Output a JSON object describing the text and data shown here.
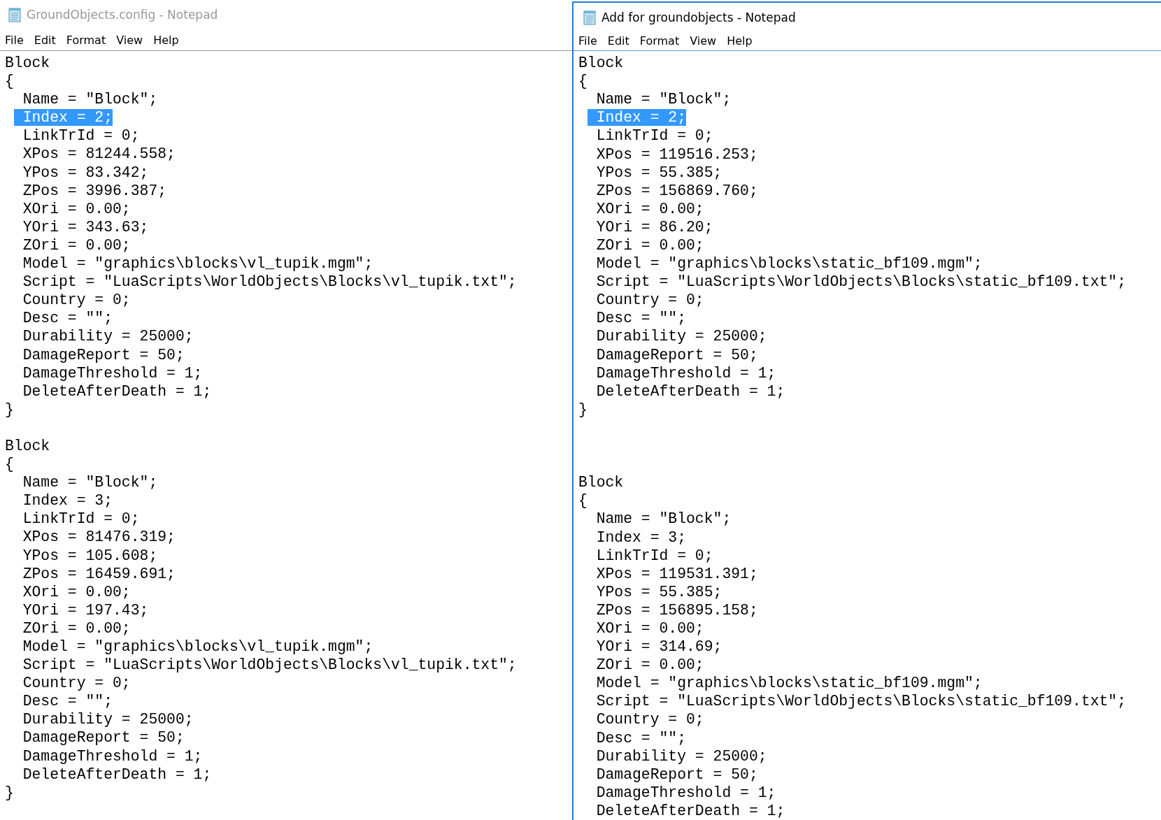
{
  "windows": [
    {
      "title": "GroundObjects.config - Notepad",
      "active": false,
      "menu": [
        "File",
        "Edit",
        "Format",
        "View",
        "Help"
      ],
      "lines": [
        {
          "kind": "text",
          "text": "Block",
          "selected": false
        },
        {
          "kind": "text",
          "text": "{",
          "selected": false
        },
        {
          "kind": "text",
          "text": "  Name = \"Block\";",
          "selected": false
        },
        {
          "kind": "text",
          "text": "  Index = 2;",
          "selected": true
        },
        {
          "kind": "text",
          "text": "  LinkTrId = 0;",
          "selected": false
        },
        {
          "kind": "text",
          "text": "  XPos = 81244.558;",
          "selected": false
        },
        {
          "kind": "text",
          "text": "  YPos = 83.342;",
          "selected": false
        },
        {
          "kind": "text",
          "text": "  ZPos = 3996.387;",
          "selected": false
        },
        {
          "kind": "text",
          "text": "  XOri = 0.00;",
          "selected": false
        },
        {
          "kind": "text",
          "text": "  YOri = 343.63;",
          "selected": false
        },
        {
          "kind": "text",
          "text": "  ZOri = 0.00;",
          "selected": false
        },
        {
          "kind": "text",
          "text": "  Model = \"graphics\\blocks\\vl_tupik.mgm\";",
          "selected": false
        },
        {
          "kind": "text",
          "text": "  Script = \"LuaScripts\\WorldObjects\\Blocks\\vl_tupik.txt\";",
          "selected": false
        },
        {
          "kind": "text",
          "text": "  Country = 0;",
          "selected": false
        },
        {
          "kind": "text",
          "text": "  Desc = \"\";",
          "selected": false
        },
        {
          "kind": "text",
          "text": "  Durability = 25000;",
          "selected": false
        },
        {
          "kind": "text",
          "text": "  DamageReport = 50;",
          "selected": false
        },
        {
          "kind": "text",
          "text": "  DamageThreshold = 1;",
          "selected": false
        },
        {
          "kind": "text",
          "text": "  DeleteAfterDeath = 1;",
          "selected": false
        },
        {
          "kind": "text",
          "text": "}",
          "selected": false
        },
        {
          "kind": "blank"
        },
        {
          "kind": "text",
          "text": "Block",
          "selected": false
        },
        {
          "kind": "text",
          "text": "{",
          "selected": false
        },
        {
          "kind": "text",
          "text": "  Name = \"Block\";",
          "selected": false
        },
        {
          "kind": "text",
          "text": "  Index = 3;",
          "selected": false
        },
        {
          "kind": "text",
          "text": "  LinkTrId = 0;",
          "selected": false
        },
        {
          "kind": "text",
          "text": "  XPos = 81476.319;",
          "selected": false
        },
        {
          "kind": "text",
          "text": "  YPos = 105.608;",
          "selected": false
        },
        {
          "kind": "text",
          "text": "  ZPos = 16459.691;",
          "selected": false
        },
        {
          "kind": "text",
          "text": "  XOri = 0.00;",
          "selected": false
        },
        {
          "kind": "text",
          "text": "  YOri = 197.43;",
          "selected": false
        },
        {
          "kind": "text",
          "text": "  ZOri = 0.00;",
          "selected": false
        },
        {
          "kind": "text",
          "text": "  Model = \"graphics\\blocks\\vl_tupik.mgm\";",
          "selected": false
        },
        {
          "kind": "text",
          "text": "  Script = \"LuaScripts\\WorldObjects\\Blocks\\vl_tupik.txt\";",
          "selected": false
        },
        {
          "kind": "text",
          "text": "  Country = 0;",
          "selected": false
        },
        {
          "kind": "text",
          "text": "  Desc = \"\";",
          "selected": false
        },
        {
          "kind": "text",
          "text": "  Durability = 25000;",
          "selected": false
        },
        {
          "kind": "text",
          "text": "  DamageReport = 50;",
          "selected": false
        },
        {
          "kind": "text",
          "text": "  DamageThreshold = 1;",
          "selected": false
        },
        {
          "kind": "text",
          "text": "  DeleteAfterDeath = 1;",
          "selected": false
        },
        {
          "kind": "text",
          "text": "}",
          "selected": false
        }
      ]
    },
    {
      "title": "Add for groundobjects - Notepad",
      "active": true,
      "menu": [
        "File",
        "Edit",
        "Format",
        "View",
        "Help"
      ],
      "lines": [
        {
          "kind": "text",
          "text": "Block",
          "selected": false
        },
        {
          "kind": "text",
          "text": "{",
          "selected": false
        },
        {
          "kind": "text",
          "text": "  Name = \"Block\";",
          "selected": false
        },
        {
          "kind": "text",
          "text": "  Index = 2;",
          "selected": true
        },
        {
          "kind": "text",
          "text": "  LinkTrId = 0;",
          "selected": false
        },
        {
          "kind": "text",
          "text": "  XPos = 119516.253;",
          "selected": false
        },
        {
          "kind": "text",
          "text": "  YPos = 55.385;",
          "selected": false
        },
        {
          "kind": "text",
          "text": "  ZPos = 156869.760;",
          "selected": false
        },
        {
          "kind": "text",
          "text": "  XOri = 0.00;",
          "selected": false
        },
        {
          "kind": "text",
          "text": "  YOri = 86.20;",
          "selected": false
        },
        {
          "kind": "text",
          "text": "  ZOri = 0.00;",
          "selected": false
        },
        {
          "kind": "text",
          "text": "  Model = \"graphics\\blocks\\static_bf109.mgm\";",
          "selected": false
        },
        {
          "kind": "text",
          "text": "  Script = \"LuaScripts\\WorldObjects\\Blocks\\static_bf109.txt\";",
          "selected": false
        },
        {
          "kind": "text",
          "text": "  Country = 0;",
          "selected": false
        },
        {
          "kind": "text",
          "text": "  Desc = \"\";",
          "selected": false
        },
        {
          "kind": "text",
          "text": "  Durability = 25000;",
          "selected": false
        },
        {
          "kind": "text",
          "text": "  DamageReport = 50;",
          "selected": false
        },
        {
          "kind": "text",
          "text": "  DamageThreshold = 1;",
          "selected": false
        },
        {
          "kind": "text",
          "text": "  DeleteAfterDeath = 1;",
          "selected": false
        },
        {
          "kind": "text",
          "text": "}",
          "selected": false
        },
        {
          "kind": "blank"
        },
        {
          "kind": "blank"
        },
        {
          "kind": "blank"
        },
        {
          "kind": "text",
          "text": "Block",
          "selected": false
        },
        {
          "kind": "text",
          "text": "{",
          "selected": false
        },
        {
          "kind": "text",
          "text": "  Name = \"Block\";",
          "selected": false
        },
        {
          "kind": "text",
          "text": "  Index = 3;",
          "selected": false
        },
        {
          "kind": "text",
          "text": "  LinkTrId = 0;",
          "selected": false
        },
        {
          "kind": "text",
          "text": "  XPos = 119531.391;",
          "selected": false
        },
        {
          "kind": "text",
          "text": "  YPos = 55.385;",
          "selected": false
        },
        {
          "kind": "text",
          "text": "  ZPos = 156895.158;",
          "selected": false
        },
        {
          "kind": "text",
          "text": "  XOri = 0.00;",
          "selected": false
        },
        {
          "kind": "text",
          "text": "  YOri = 314.69;",
          "selected": false
        },
        {
          "kind": "text",
          "text": "  ZOri = 0.00;",
          "selected": false
        },
        {
          "kind": "text",
          "text": "  Model = \"graphics\\blocks\\static_bf109.mgm\";",
          "selected": false
        },
        {
          "kind": "text",
          "text": "  Script = \"LuaScripts\\WorldObjects\\Blocks\\static_bf109.txt\";",
          "selected": false
        },
        {
          "kind": "text",
          "text": "  Country = 0;",
          "selected": false
        },
        {
          "kind": "text",
          "text": "  Desc = \"\";",
          "selected": false
        },
        {
          "kind": "text",
          "text": "  Durability = 25000;",
          "selected": false
        },
        {
          "kind": "text",
          "text": "  DamageReport = 50;",
          "selected": false
        },
        {
          "kind": "text",
          "text": "  DamageThreshold = 1;",
          "selected": false
        },
        {
          "kind": "text",
          "text": "  DeleteAfterDeath = 1;",
          "selected": false
        }
      ]
    }
  ]
}
